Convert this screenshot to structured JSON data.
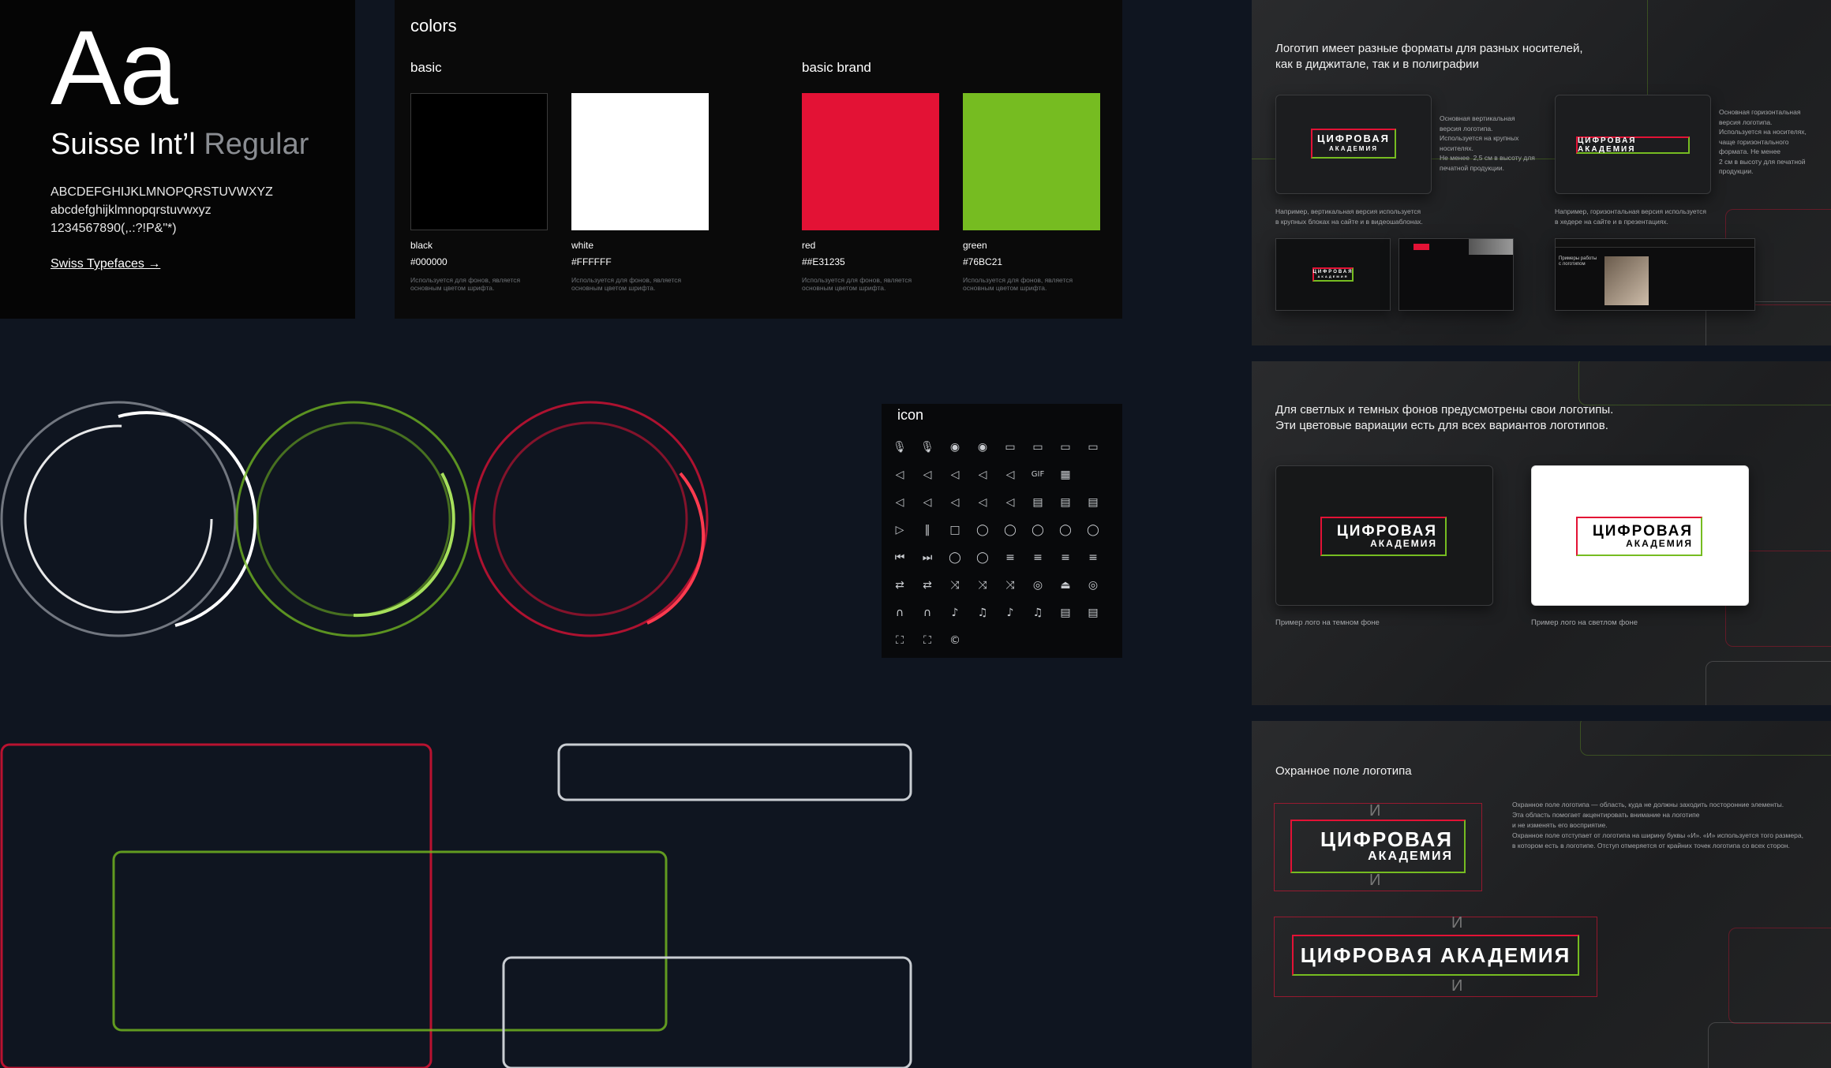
{
  "typography": {
    "sample": "Aa",
    "font_name": "Suisse Int’l",
    "font_weight": "Regular",
    "uppercase": "ABCDEFGHIJKLMNOPQRSTUVWXYZ",
    "lowercase": "abcdefghijklmnopqrstuvwxyz",
    "digits": "1234567890(,.:?!P&\"*)",
    "link": "Swiss Typefaces →"
  },
  "colors": {
    "title": "colors",
    "group_basic": "basic",
    "group_brand": "basic brand",
    "swatches": [
      {
        "name": "black",
        "hex": "#000000",
        "color": "#000000",
        "desc": "Используется для фонов, является основным цветом шрифта."
      },
      {
        "name": "white",
        "hex": "#FFFFFF",
        "color": "#FFFFFF",
        "desc": "Используется для фонов, является основным цветом шрифта."
      },
      {
        "name": "red",
        "hex": "##E31235",
        "color": "#E31235",
        "desc": "Используется для фонов, является основным цветом шрифта."
      },
      {
        "name": "green",
        "hex": "#76BC21",
        "color": "#76BC21",
        "desc": "Используется для фонов, является основным цветом шрифта."
      }
    ]
  },
  "icons": {
    "title": "icon",
    "items": [
      "microphone-icon",
      "microphone-off-icon",
      "camera-icon",
      "camera-off-icon",
      "video-icon",
      "video-off-icon",
      "cast-icon",
      "screen-share-icon",
      "volume-icon",
      "volume-low-icon",
      "volume-mute-icon",
      "volume-off-icon",
      "volume-x-icon",
      "gif-icon",
      "image-icon",
      "volume-high-icon",
      "volume-medium-icon",
      "speaker-icon",
      "volume-cross-icon",
      "volume-x2-icon",
      "subtitles-icon",
      "list-icon",
      "caption-icon",
      "play-icon",
      "pause-icon",
      "stop-icon",
      "play-circle-icon",
      "pause-circle-icon",
      "record-icon",
      "rewind-circle-icon",
      "forward-circle-icon",
      "skip-back-icon",
      "skip-forward-icon",
      "rewind-icon",
      "fast-forward-icon",
      "equalizer-icon",
      "sliders-icon",
      "mixer-icon",
      "settings-sliders-icon",
      "repeat-icon",
      "repeat-one-icon",
      "shuffle-icon",
      "shuffle-alt-icon",
      "shuffle-cross-icon",
      "radio-icon",
      "eject-icon",
      "speed-icon",
      "headphones-icon",
      "headset-icon",
      "music-note-icon",
      "music-notes-icon",
      "note-icon",
      "double-note-icon",
      "playlist-icon",
      "cc-icon",
      "fullscreen-icon",
      "exit-fullscreen-icon",
      "copyright-icon"
    ],
    "glyphs": [
      "🎙",
      "🎙",
      "◉",
      "◉",
      "▭",
      "▭",
      "▭",
      "▭",
      "◁",
      "◁",
      "◁",
      "◁",
      "◁",
      "GIF",
      "▦",
      "◁",
      "◁",
      "◁",
      "◁",
      "◁",
      "▤",
      "▤",
      "▤",
      "▷",
      "‖",
      "□",
      "◯",
      "◯",
      "◯",
      "◯",
      "◯",
      "⏮",
      "⏭",
      "◯",
      "◯",
      "≡",
      "≡",
      "≡",
      "≡",
      "⇄",
      "⇄",
      "⤨",
      "⤨",
      "⤨",
      "◎",
      "⏏",
      "◎",
      "∩",
      "∩",
      "♪",
      "♫",
      "♪",
      "♫",
      "▤",
      "▤",
      "⛶",
      "⛶",
      "©"
    ]
  },
  "panel1": {
    "title": "Логотип имеет разные форматы для разных носителей,\nкак в диджитале, так и в полиграфии",
    "logo_vertical_line1": "ЦИФРОВАЯ",
    "logo_vertical_line2": "АКАДЕМИЯ",
    "logo_horizontal": "ЦИФРОВАЯ АКАДЕМИЯ",
    "desc_vertical": "Основная вертикальная\nверсия логотипа.\nИспользуется на крупных\nносителях.\nНе менее  2,5 см в высоту для\nпечатной продукции.",
    "desc_horizontal": "Основная горизонтальная\nверсия логотипа.\nИспользуется на носителях,\nчаще горизонтального\nформата. Не менее\n2 см в высоту для печатной\nпродукции.",
    "example_vertical": "Например, вертикальная версия используется\nв крупных блоках на сайте и в видеошаблонах.",
    "example_horizontal": "Например, горизонтальная версия используется\nв хедере на сайте и в презентациях.",
    "mini_logo_line1": "ЦИФРОВАЯ",
    "mini_logo_line2": "АКАДЕМИЯ",
    "thumb_text": "Примеры работы\nс логотипом"
  },
  "panel2": {
    "title": "Для светлых и темных фонов предусмотрены свои логотипы.\nЭти цветовые вариации есть для всех вариантов логотипов.",
    "logo_line1": "ЦИФРОВАЯ",
    "logo_line2": "АКАДЕМИЯ",
    "caption_dark": "Пример лого на темном фоне",
    "caption_light": "Пример лого на светлом фоне"
  },
  "panel3": {
    "title": "Охранное поле логотипа",
    "logo_line1": "ЦИФРОВАЯ",
    "logo_line2": "АКАДЕМИЯ",
    "logo_horizontal": "ЦИФРОВАЯ АКАДЕМИЯ",
    "marker": "И",
    "desc": "Охранное поле логотипа — область, куда не должны заходить посторонние элементы.\nЭта область помогает акцентировать внимание на логотипе\nи не изменять его восприятие.\nОхранное поле отступает от логотипа на ширину буквы «И». «И» используется того размера,\nв котором есть в логотипе. Отступ отмеряется от крайних точек логотипа со всех сторон."
  }
}
